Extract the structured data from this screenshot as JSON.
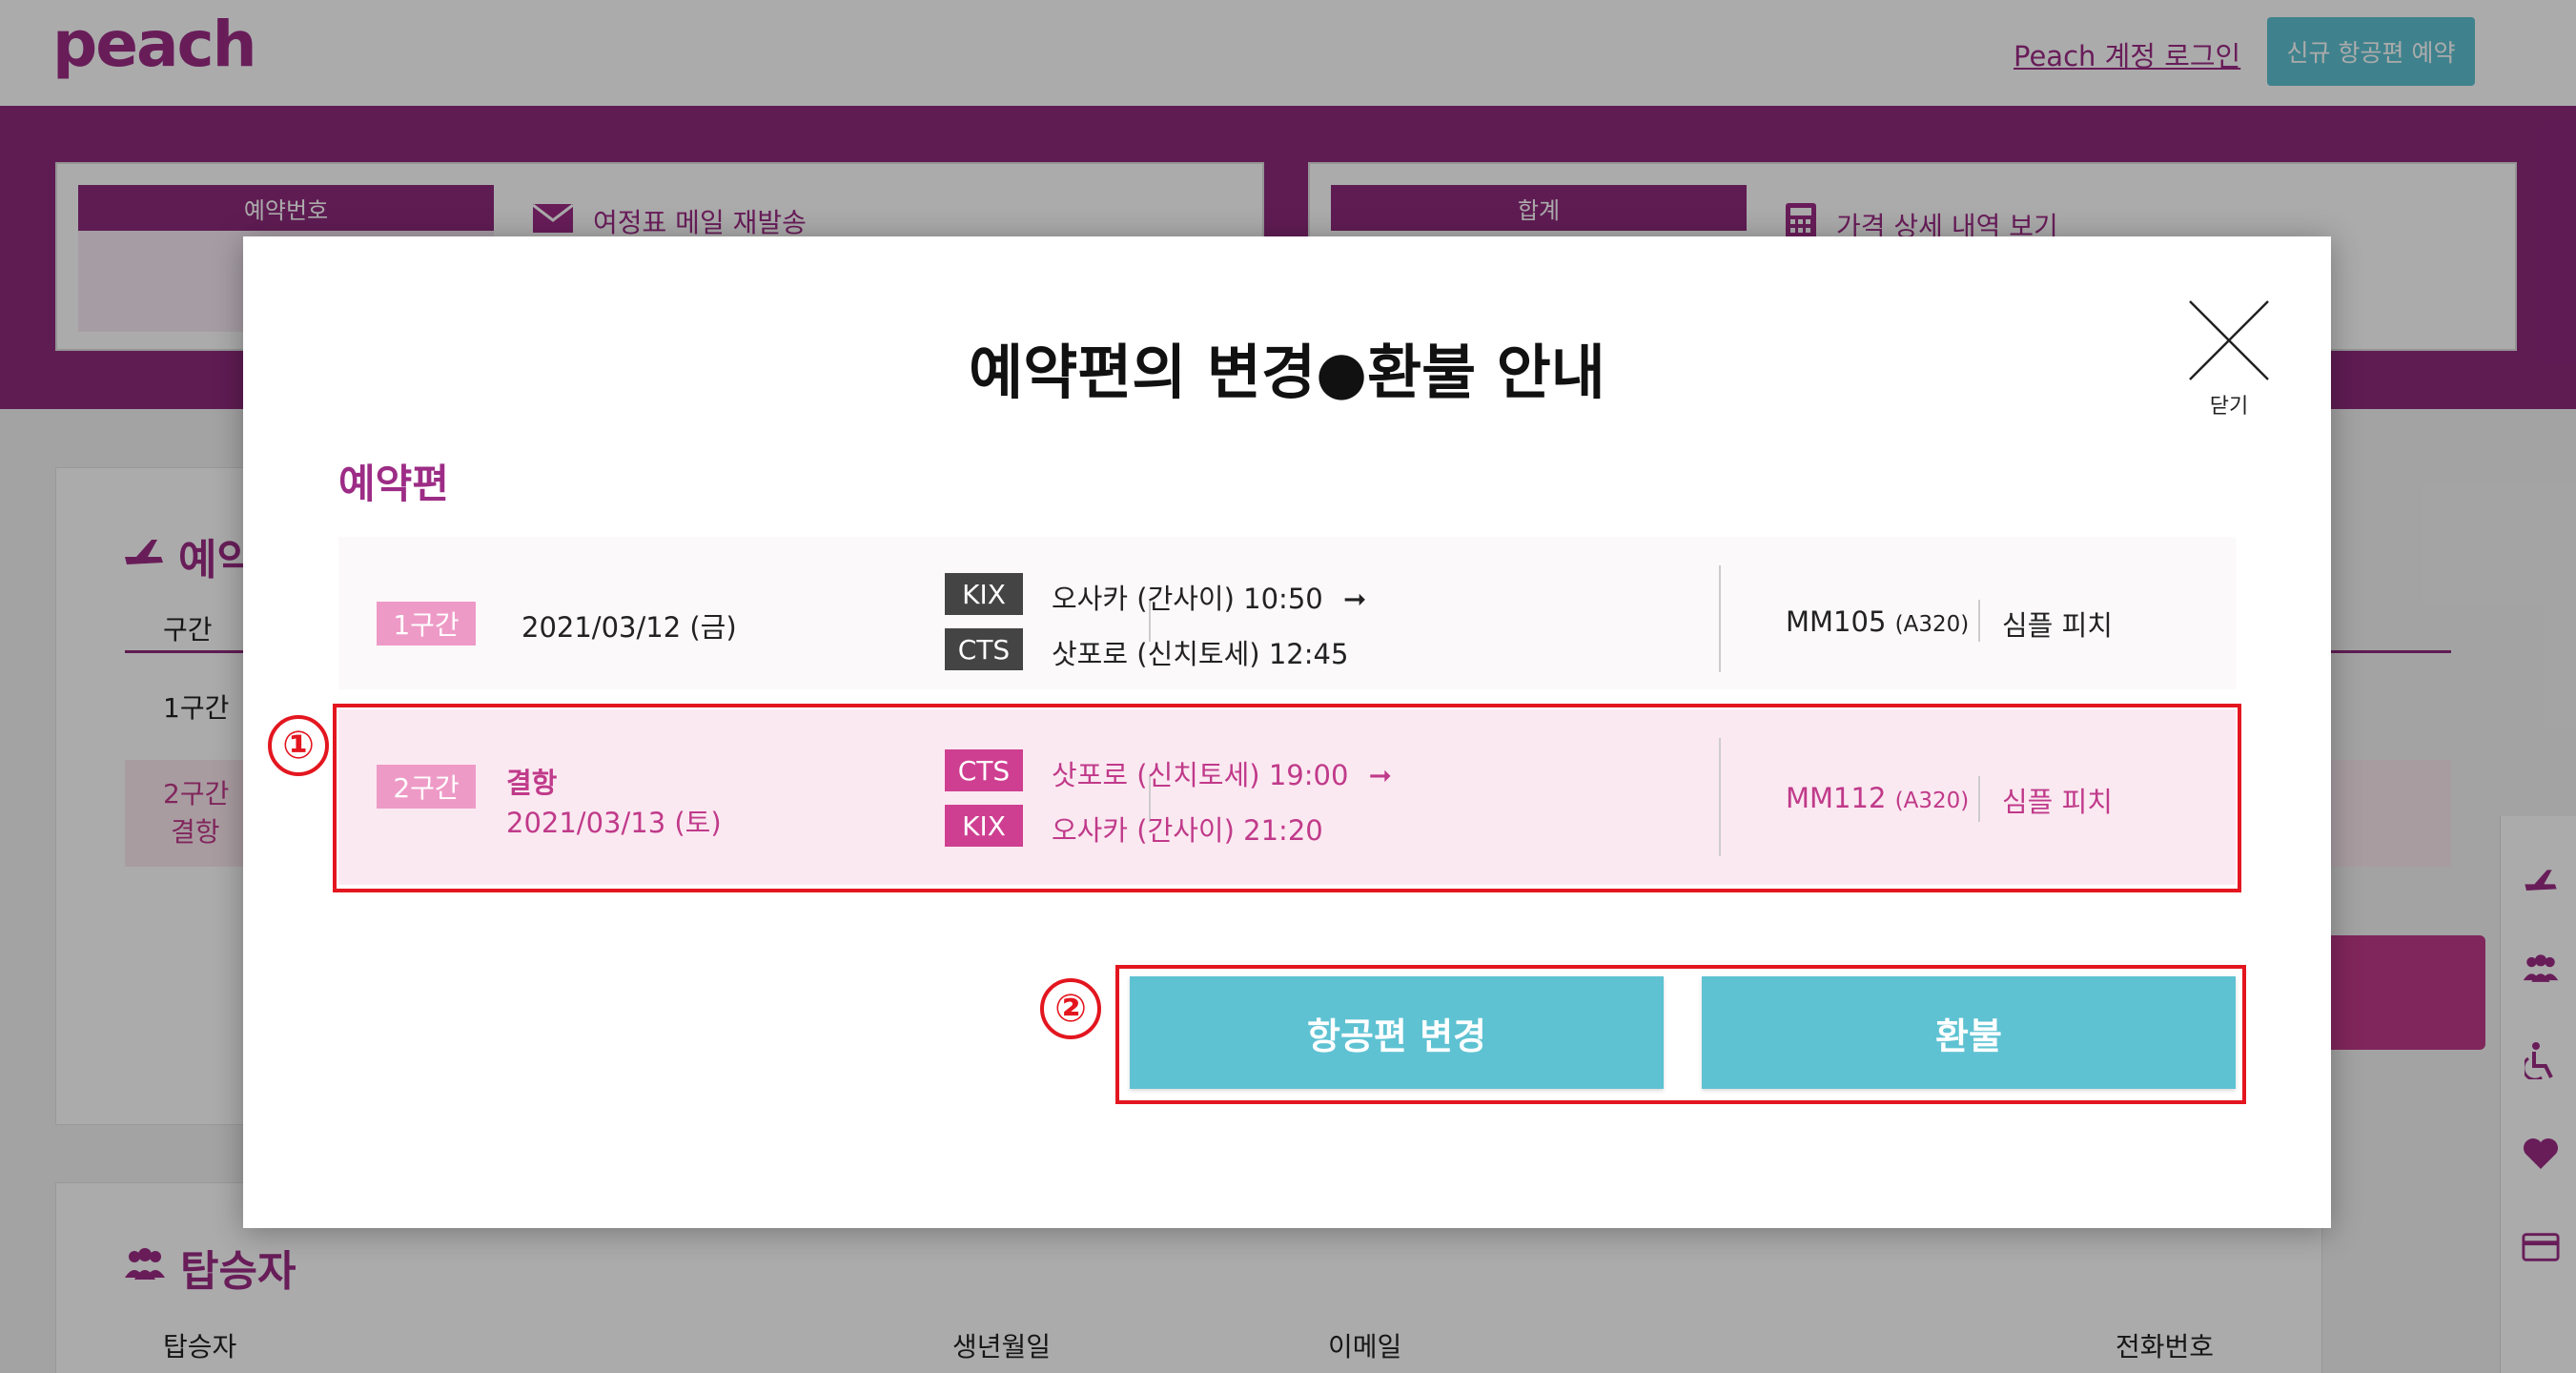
{
  "header": {
    "logo": "peach",
    "login_link": "Peach 계정 로그인",
    "new_booking_button": "신규 항공편 예약"
  },
  "info_boxes": {
    "booking_number_label": "예약번호",
    "resend_email_link": "여정표 메일 재발송",
    "total_label": "합계",
    "price_detail_link": "가격 상세 내역 보기"
  },
  "background": {
    "booking_card_title": "예약",
    "segment_column": "구간",
    "row1_segment": "1구간",
    "row2_segment": "2구간",
    "row2_status": "결항",
    "passengers_title": "탑승자",
    "passengers_columns": [
      "탑승자",
      "생년월일",
      "이메일",
      "전화번호"
    ]
  },
  "modal": {
    "title": "예약편의 변경●환불 안내",
    "close_label": "닫기",
    "section_label": "예약편",
    "flights": [
      {
        "segment": "1구간",
        "status": "",
        "date": "2021/03/12 (금)",
        "from_code": "KIX",
        "from_text": "오사카 (간사이) 10:50",
        "to_code": "CTS",
        "to_text": "삿포로 (신치토세) 12:45",
        "flight_no": "MM105",
        "aircraft": "(A320)",
        "fare": "심플 피치"
      },
      {
        "segment": "2구간",
        "status": "결항",
        "date": "2021/03/13 (토)",
        "from_code": "CTS",
        "from_text": "삿포로 (신치토세) 19:00",
        "to_code": "KIX",
        "to_text": "오사카 (간사이) 21:20",
        "flight_no": "MM112",
        "aircraft": "(A320)",
        "fare": "심플 피치"
      }
    ],
    "change_button": "항공편 변경",
    "refund_button": "환불",
    "marker_1": "①",
    "marker_2": "②"
  },
  "colors": {
    "brand_purple": "#8e2a7d",
    "accent_teal": "#5ec2d2",
    "cancel_pink": "#c03a8a",
    "highlight_red": "#e3161f"
  }
}
